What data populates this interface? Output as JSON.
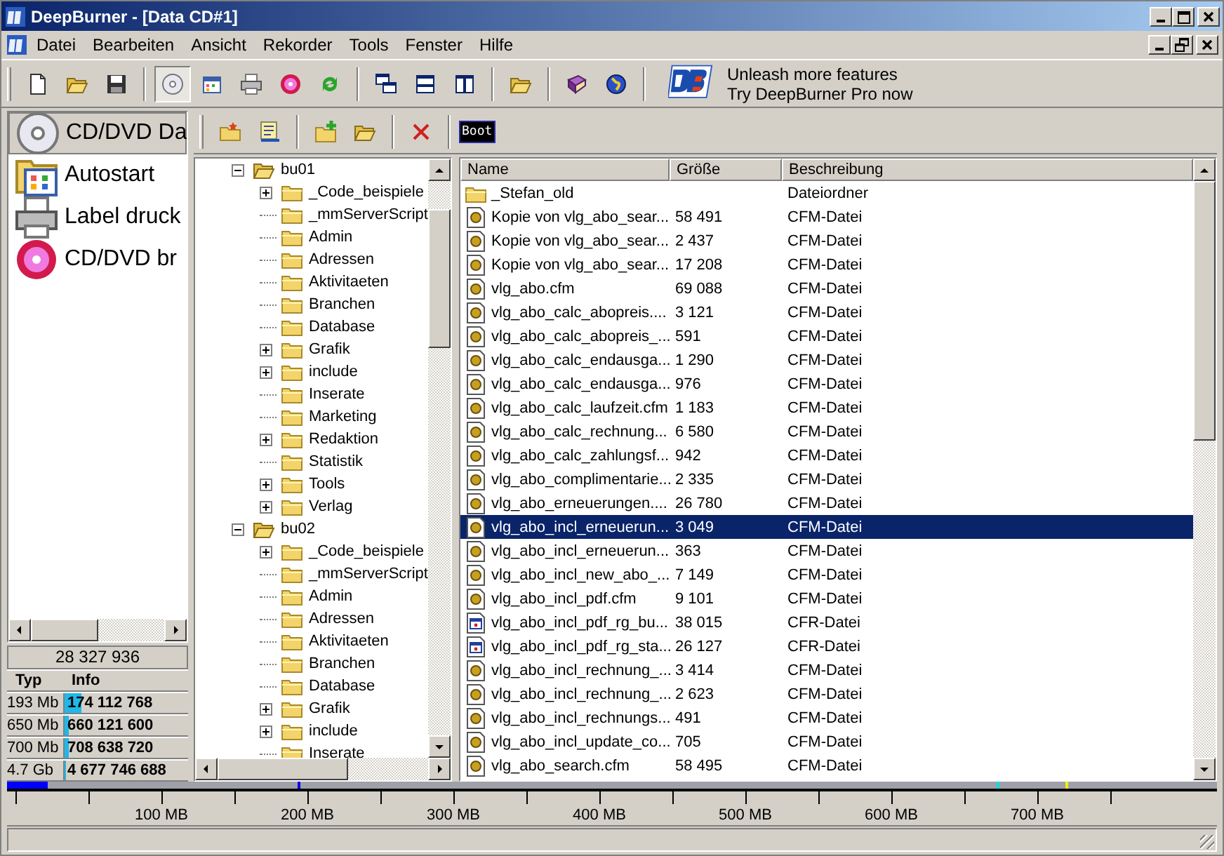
{
  "window": {
    "title": "DeepBurner - [Data CD#1]"
  },
  "menu": [
    "Datei",
    "Bearbeiten",
    "Ansicht",
    "Rekorder",
    "Tools",
    "Fenster",
    "Hilfe"
  ],
  "promo": {
    "line_1": "Unleash more features",
    "line_2": "Try DeepBurner Pro now"
  },
  "toolbar_2": {
    "boot_label": "Boot"
  },
  "projects": [
    {
      "label": "CD/DVD Da",
      "selected": true,
      "kind": "disc"
    },
    {
      "label": "Autostart",
      "selected": false,
      "kind": "autostart"
    },
    {
      "label": "Label druck",
      "selected": false,
      "kind": "printer"
    },
    {
      "label": "CD/DVD br",
      "selected": false,
      "kind": "burn"
    }
  ],
  "total": "28 327 936",
  "capacity": {
    "columns": [
      "Typ",
      "Info"
    ],
    "rows": [
      {
        "type": "193 Mb",
        "info": "174 112 768",
        "level": 0.14
      },
      {
        "type": "650 Mb",
        "info": "660 121 600",
        "level": 0.03
      },
      {
        "type": "700 Mb",
        "info": "708 638 720",
        "level": 0.03
      },
      {
        "type": "4.7 Gb",
        "info": "4 677 746 688",
        "level": 0.01
      }
    ]
  },
  "tree": [
    {
      "label": "bu01",
      "kind": "expanded",
      "children": [
        {
          "label": "_Code_beispiele",
          "kind": "collapsed"
        },
        {
          "label": "_mmServerScript",
          "kind": "leaf"
        },
        {
          "label": "Admin",
          "kind": "leaf"
        },
        {
          "label": "Adressen",
          "kind": "leaf"
        },
        {
          "label": "Aktivitaeten",
          "kind": "leaf"
        },
        {
          "label": "Branchen",
          "kind": "leaf"
        },
        {
          "label": "Database",
          "kind": "leaf"
        },
        {
          "label": "Grafik",
          "kind": "collapsed"
        },
        {
          "label": "include",
          "kind": "collapsed"
        },
        {
          "label": "Inserate",
          "kind": "leaf"
        },
        {
          "label": "Marketing",
          "kind": "leaf"
        },
        {
          "label": "Redaktion",
          "kind": "collapsed"
        },
        {
          "label": "Statistik",
          "kind": "leaf"
        },
        {
          "label": "Tools",
          "kind": "collapsed"
        },
        {
          "label": "Verlag",
          "kind": "collapsed"
        }
      ]
    },
    {
      "label": "bu02",
      "kind": "expanded",
      "children": [
        {
          "label": "_Code_beispiele",
          "kind": "collapsed"
        },
        {
          "label": "_mmServerScript",
          "kind": "leaf"
        },
        {
          "label": "Admin",
          "kind": "leaf"
        },
        {
          "label": "Adressen",
          "kind": "leaf"
        },
        {
          "label": "Aktivitaeten",
          "kind": "leaf"
        },
        {
          "label": "Branchen",
          "kind": "leaf"
        },
        {
          "label": "Database",
          "kind": "leaf"
        },
        {
          "label": "Grafik",
          "kind": "collapsed"
        },
        {
          "label": "include",
          "kind": "collapsed"
        },
        {
          "label": "Inserate",
          "kind": "leaf"
        }
      ]
    }
  ],
  "files": {
    "columns": [
      "Name",
      "Größe",
      "Beschreibung"
    ],
    "rows": [
      {
        "name": "_Stefan_old",
        "size": "",
        "description": "Dateiordner",
        "kind": "folder",
        "selected": false
      },
      {
        "name": "Kopie von vlg_abo_sear...",
        "size": "58 491",
        "description": "CFM-Datei",
        "kind": "cfm",
        "selected": false
      },
      {
        "name": "Kopie von vlg_abo_sear...",
        "size": "2 437",
        "description": "CFM-Datei",
        "kind": "cfm",
        "selected": false
      },
      {
        "name": "Kopie von vlg_abo_sear...",
        "size": "17 208",
        "description": "CFM-Datei",
        "kind": "cfm",
        "selected": false
      },
      {
        "name": "vlg_abo.cfm",
        "size": "69 088",
        "description": "CFM-Datei",
        "kind": "cfm",
        "selected": false
      },
      {
        "name": "vlg_abo_calc_abopreis....",
        "size": "3 121",
        "description": "CFM-Datei",
        "kind": "cfm",
        "selected": false
      },
      {
        "name": "vlg_abo_calc_abopreis_...",
        "size": "591",
        "description": "CFM-Datei",
        "kind": "cfm",
        "selected": false
      },
      {
        "name": "vlg_abo_calc_endausga...",
        "size": "1 290",
        "description": "CFM-Datei",
        "kind": "cfm",
        "selected": false
      },
      {
        "name": "vlg_abo_calc_endausga...",
        "size": "976",
        "description": "CFM-Datei",
        "kind": "cfm",
        "selected": false
      },
      {
        "name": "vlg_abo_calc_laufzeit.cfm",
        "size": "1 183",
        "description": "CFM-Datei",
        "kind": "cfm",
        "selected": false
      },
      {
        "name": "vlg_abo_calc_rechnung...",
        "size": "6 580",
        "description": "CFM-Datei",
        "kind": "cfm",
        "selected": false
      },
      {
        "name": "vlg_abo_calc_zahlungsf...",
        "size": "942",
        "description": "CFM-Datei",
        "kind": "cfm",
        "selected": false
      },
      {
        "name": "vlg_abo_complimentarie...",
        "size": "2 335",
        "description": "CFM-Datei",
        "kind": "cfm",
        "selected": false
      },
      {
        "name": "vlg_abo_erneuerungen....",
        "size": "26 780",
        "description": "CFM-Datei",
        "kind": "cfm",
        "selected": false
      },
      {
        "name": "vlg_abo_incl_erneuerun...",
        "size": "3 049",
        "description": "CFM-Datei",
        "kind": "cfm",
        "selected": true
      },
      {
        "name": "vlg_abo_incl_erneuerun...",
        "size": "363",
        "description": "CFM-Datei",
        "kind": "cfm",
        "selected": false
      },
      {
        "name": "vlg_abo_incl_new_abo_...",
        "size": "7 149",
        "description": "CFM-Datei",
        "kind": "cfm",
        "selected": false
      },
      {
        "name": "vlg_abo_incl_pdf.cfm",
        "size": "9 101",
        "description": "CFM-Datei",
        "kind": "cfm",
        "selected": false
      },
      {
        "name": "vlg_abo_incl_pdf_rg_bu...",
        "size": "38 015",
        "description": "CFR-Datei",
        "kind": "cfr",
        "selected": false
      },
      {
        "name": "vlg_abo_incl_pdf_rg_sta...",
        "size": "26 127",
        "description": "CFR-Datei",
        "kind": "cfr",
        "selected": false
      },
      {
        "name": "vlg_abo_incl_rechnung_...",
        "size": "3 414",
        "description": "CFM-Datei",
        "kind": "cfm",
        "selected": false
      },
      {
        "name": "vlg_abo_incl_rechnung_...",
        "size": "2 623",
        "description": "CFM-Datei",
        "kind": "cfm",
        "selected": false
      },
      {
        "name": "vlg_abo_incl_rechnungs...",
        "size": "491",
        "description": "CFM-Datei",
        "kind": "cfm",
        "selected": false
      },
      {
        "name": "vlg_abo_incl_update_co...",
        "size": "705",
        "description": "CFM-Datei",
        "kind": "cfm",
        "selected": false
      },
      {
        "name": "vlg_abo_search.cfm",
        "size": "58 495",
        "description": "CFM-Datei",
        "kind": "cfm",
        "selected": false
      }
    ]
  },
  "ruler": {
    "level": 0.034,
    "labels": [
      "100 MB",
      "200 MB",
      "300 MB",
      "400 MB",
      "500 MB",
      "600 MB",
      "700 MB"
    ]
  }
}
